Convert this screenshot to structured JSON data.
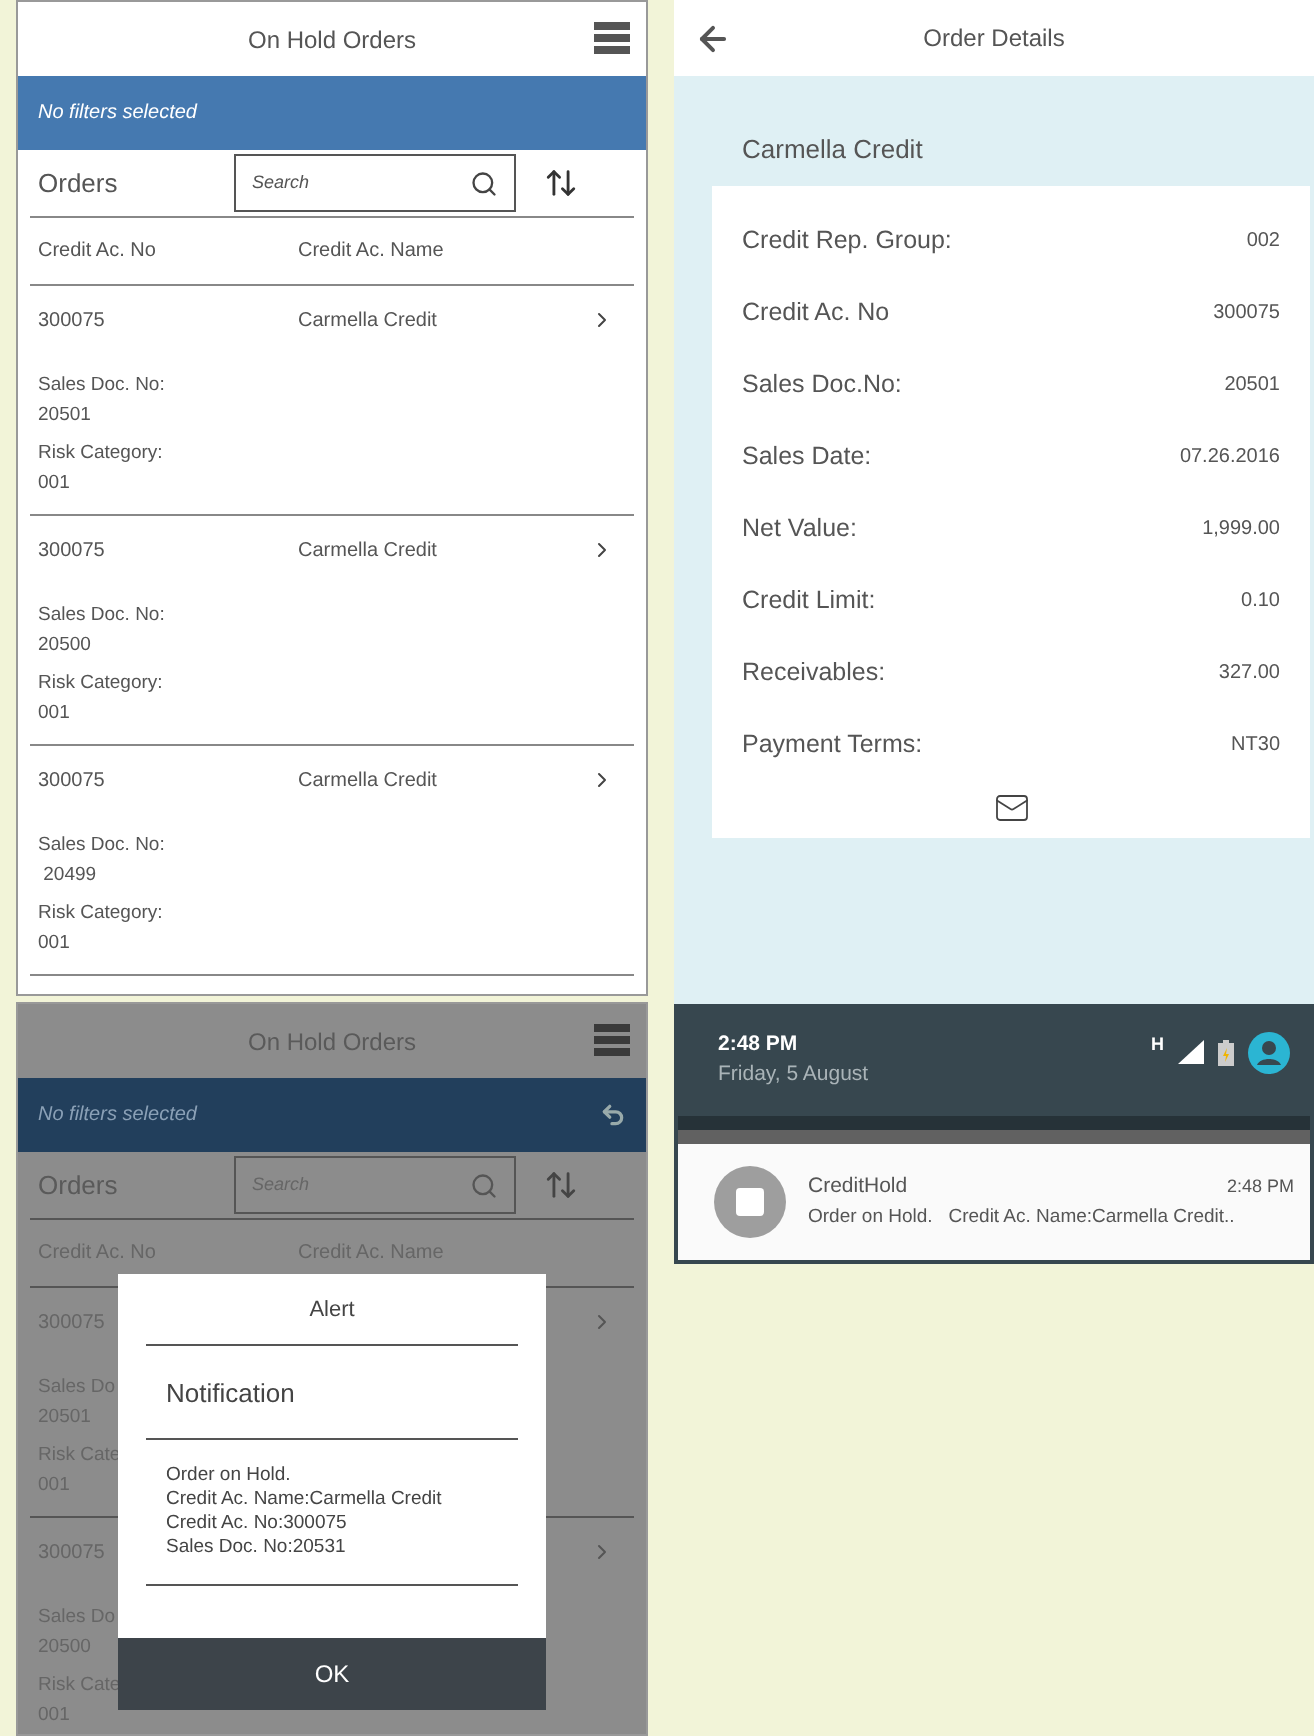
{
  "orders_screen": {
    "title": "On Hold Orders",
    "filter_bar": {
      "text": "No filters selected"
    },
    "list_title": "Orders",
    "search": {
      "placeholder": "Search"
    },
    "columns": [
      "Credit Ac. No",
      "Credit Ac. Name"
    ],
    "rows": [
      {
        "account_no": "300075",
        "account_name": "Carmella Credit",
        "doc_label": "Sales Doc. No:",
        "doc_no": "20501",
        "risk_label": "Risk Category:",
        "risk": "001"
      },
      {
        "account_no": "300075",
        "account_name": "Carmella Credit",
        "doc_label": "Sales Doc. No:",
        "doc_no": "20500",
        "risk_label": "Risk Category:",
        "risk": "001"
      },
      {
        "account_no": "300075",
        "account_name": "Carmella Credit",
        "doc_label": "Sales Doc. No:",
        "doc_no": " 20499",
        "risk_label": "Risk Category:",
        "risk": "001"
      }
    ]
  },
  "alert_screen": {
    "title": "On Hold Orders",
    "filter_bar": {
      "text": "No filters selected",
      "undo": true
    },
    "list_title": "Orders",
    "search": {
      "placeholder": "Search"
    },
    "columns": [
      "Credit Ac. No",
      "Credit Ac. Name"
    ],
    "rows": [
      {
        "account_no": "300075",
        "doc_label": "Sales Do",
        "doc_no": "20501",
        "risk_label": "Risk Cate",
        "risk": "001"
      },
      {
        "account_no": "300075",
        "doc_label": "Sales Do",
        "doc_no": "20500",
        "risk_label": "Risk Cate",
        "risk": "001"
      }
    ],
    "alert": {
      "title": "Alert",
      "heading": "Notification",
      "lines": [
        "Order on Hold.",
        "Credit Ac. Name:Carmella Credit",
        "Credit Ac. No:300075",
        "Sales Doc. No:20531"
      ],
      "button": "OK"
    }
  },
  "details_screen": {
    "title": "Order Details",
    "customer": "Carmella Credit",
    "fields": [
      {
        "label": "Credit Rep. Group:",
        "value": "002"
      },
      {
        "label": "Credit Ac. No",
        "value": "300075"
      },
      {
        "label": "Sales Doc.No:",
        "value": "20501"
      },
      {
        "label": "Sales Date:",
        "value": "07.26.2016"
      },
      {
        "label": "Net Value:",
        "value": "1,999.00"
      },
      {
        "label": "Credit Limit:",
        "value": "0.10"
      },
      {
        "label": "Receivables:",
        "value": "327.00"
      },
      {
        "label": "Payment Terms:",
        "value": "NT30"
      }
    ]
  },
  "notification_shade": {
    "time": "2:48 PM",
    "date": "Friday, 5 August",
    "network": "H",
    "notification": {
      "app": "CreditHold",
      "time": "2:48 PM",
      "text": "Order on Hold.   Credit Ac. Name:Carmella Credit.."
    }
  }
}
